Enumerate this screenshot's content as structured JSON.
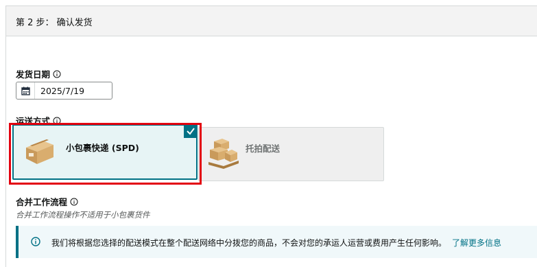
{
  "step": {
    "title": "第 2 步： 确认发货"
  },
  "ship_date": {
    "label": "发货日期",
    "value": "2025/7/19"
  },
  "shipping_method": {
    "label": "运送方式",
    "options": [
      {
        "label": "小包裹快递 (SPD)",
        "selected": true
      },
      {
        "label": "托拍配送",
        "selected": false
      }
    ]
  },
  "merge_workflow": {
    "label": "合并工作流程",
    "helper": "合并工作流程操作不适用于小包裹货件"
  },
  "info_banner": {
    "text": "我们将根据您选择的配送模式在整个配送网络中分拨您的商品，不会对您的承运人运营或费用产生任何影响。",
    "link": "了解更多信息"
  },
  "colors": {
    "accent": "#007185",
    "selected_bg": "#e7f4f5",
    "highlight": "#e3000f"
  }
}
